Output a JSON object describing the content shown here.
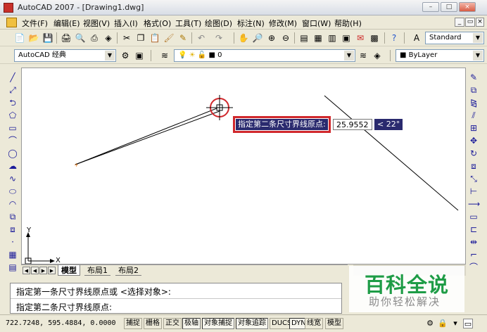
{
  "window": {
    "title": "AutoCAD 2007 - [Drawing1.dwg]",
    "min": "–",
    "max": "□",
    "close": "×"
  },
  "menus": [
    "文件(F)",
    "编辑(E)",
    "视图(V)",
    "插入(I)",
    "格式(O)",
    "工具(T)",
    "绘图(D)",
    "标注(N)",
    "修改(M)",
    "窗口(W)",
    "帮助(H)"
  ],
  "mdi": {
    "min": "_",
    "restore": "▭",
    "close": "×"
  },
  "toolbar": {
    "text_style": "Standard",
    "workspace": "AutoCAD 经典",
    "layer": "0",
    "color": "ByLayer"
  },
  "canvas": {
    "prompt": "指定第二条尺寸界线原点:",
    "length_value": "25.9552",
    "angle_value": "< 22°",
    "ucs_y": "Y",
    "ucs_x": "X"
  },
  "tabs": [
    "模型",
    "布局1",
    "布局2"
  ],
  "command_lines": [
    "指定第一条尺寸界线原点或 <选择对象>:",
    "指定第二条尺寸界线原点:"
  ],
  "watermark": {
    "main": "百科全说",
    "sub": "助你轻松解决"
  },
  "status": {
    "coords": "722.7248, 595.4884, 0.0000",
    "buttons": [
      "捕捉",
      "栅格",
      "正交",
      "极轴",
      "对象捕捉",
      "对象追踪",
      "DUCS",
      "DYN",
      "线宽",
      "模型"
    ]
  },
  "colors": {
    "prompt_bg": "#2a2a6e",
    "highlight": "#d0282c",
    "watermark": "#1e9c46"
  }
}
